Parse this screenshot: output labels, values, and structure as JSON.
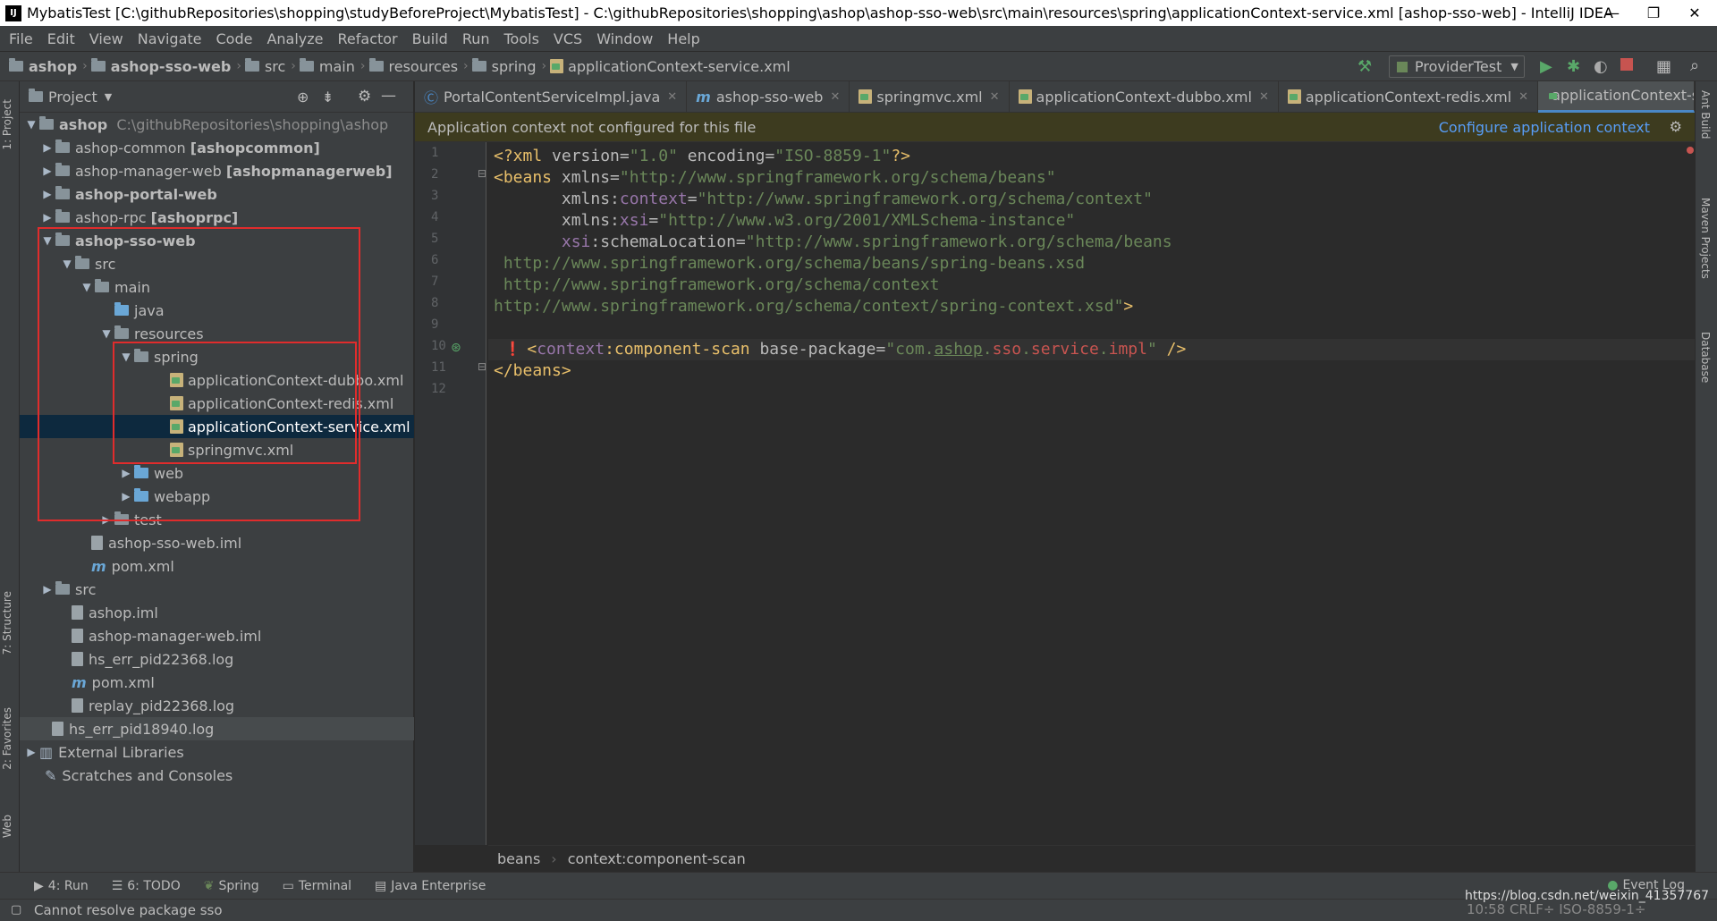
{
  "window": {
    "title": "MybatisTest [C:\\githubRepositories\\shopping\\studyBeforeProject\\MybatisTest] - C:\\githubRepositories\\shopping\\ashop\\ashop-sso-web\\src\\main\\resources\\spring\\applicationContext-service.xml [ashop-sso-web] - IntelliJ IDEA",
    "minimize": "—",
    "restore": "❐",
    "close": "✕"
  },
  "menu": [
    "File",
    "Edit",
    "View",
    "Navigate",
    "Code",
    "Analyze",
    "Refactor",
    "Build",
    "Run",
    "Tools",
    "VCS",
    "Window",
    "Help"
  ],
  "breadcrumbs": [
    "ashop",
    "ashop-sso-web",
    "src",
    "main",
    "resources",
    "spring",
    "applicationContext-service.xml"
  ],
  "run_config": "ProviderTest",
  "project_panel": {
    "title": "Project",
    "tree": [
      {
        "label": "ashop",
        "extra": "C:\\githubRepositories\\shopping\\ashop",
        "bold": true
      },
      {
        "label": "ashop-common",
        "extra": "[ashopcommon]"
      },
      {
        "label": "ashop-manager-web",
        "extra": "[ashopmanagerweb]"
      },
      {
        "label": "ashop-portal-web",
        "extra": ""
      },
      {
        "label": "ashop-rpc",
        "extra": "[ashoprpc]"
      },
      {
        "label": "ashop-sso-web",
        "extra": ""
      },
      {
        "label": "src",
        "extra": ""
      },
      {
        "label": "main",
        "extra": ""
      },
      {
        "label": "java",
        "extra": ""
      },
      {
        "label": "resources",
        "extra": ""
      },
      {
        "label": "spring",
        "extra": ""
      },
      {
        "label": "applicationContext-dubbo.xml",
        "extra": ""
      },
      {
        "label": "applicationContext-redis.xml",
        "extra": ""
      },
      {
        "label": "applicationContext-service.xml",
        "extra": ""
      },
      {
        "label": "springmvc.xml",
        "extra": ""
      },
      {
        "label": "web",
        "extra": ""
      },
      {
        "label": "webapp",
        "extra": ""
      },
      {
        "label": "test",
        "extra": ""
      },
      {
        "label": "ashop-sso-web.iml",
        "extra": ""
      },
      {
        "label": "pom.xml",
        "extra": ""
      },
      {
        "label": "src",
        "extra": ""
      },
      {
        "label": "ashop.iml",
        "extra": ""
      },
      {
        "label": "ashop-manager-web.iml",
        "extra": ""
      },
      {
        "label": "hs_err_pid22368.log",
        "extra": ""
      },
      {
        "label": "pom.xml",
        "extra": ""
      },
      {
        "label": "replay_pid22368.log",
        "extra": ""
      },
      {
        "label": "hs_err_pid18940.log",
        "extra": ""
      },
      {
        "label": "External Libraries",
        "extra": ""
      },
      {
        "label": "Scratches and Consoles",
        "extra": ""
      }
    ]
  },
  "tabs": [
    "PortalContentServiceImpl.java",
    "ashop-sso-web",
    "springmvc.xml",
    "applicationContext-dubbo.xml",
    "applicationContext-redis.xml",
    "applicationContext-service.xml"
  ],
  "banner": {
    "message": "Application context not configured for this file",
    "action": "Configure application context"
  },
  "code_lines": [
    "1",
    "2",
    "3",
    "4",
    "5",
    "6",
    "7",
    "8",
    "9",
    "10",
    "11",
    "12"
  ],
  "code_breadcrumb": [
    "beans",
    "context:component-scan"
  ],
  "left_tools": [
    "1: Project",
    "7: Structure",
    "2: Favorites",
    "Web"
  ],
  "right_tools": [
    "Ant Build",
    "Maven Projects",
    "Database"
  ],
  "bottom_tools": [
    "4: Run",
    "6: TODO",
    "Spring",
    "Terminal",
    "Java Enterprise"
  ],
  "event_log": "Event Log",
  "status": {
    "message": "Cannot resolve package sso",
    "right": "10:58  CRLF÷  ISO-8859-1÷",
    "watermark": "https://blog.csdn.net/weixin_41357767"
  }
}
